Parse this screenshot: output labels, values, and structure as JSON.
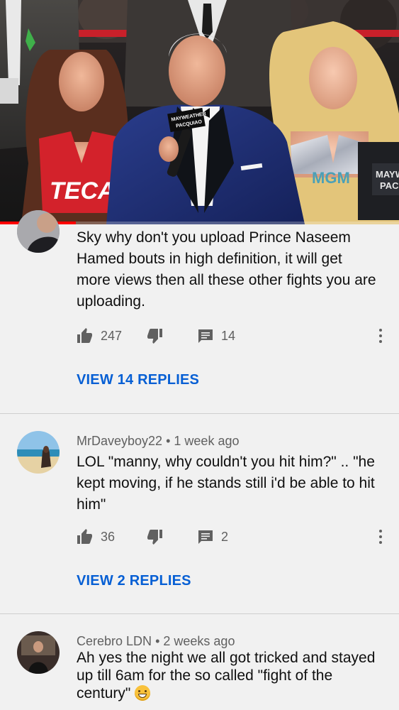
{
  "video": {
    "scene_text": {
      "mic_flag_top": "MAYWEATHER",
      "mic_flag_bottom": "PACQUIAO",
      "left_outfit": "TECATE",
      "right_outfit": "MGM",
      "camera_sign_top": "MAYW",
      "camera_sign_bottom": "PAC"
    },
    "progress_fraction": 0.19,
    "colors": {
      "progress": "#ff0000"
    }
  },
  "comments": [
    {
      "author": "",
      "age": "",
      "avatar": "avatar-photo",
      "text_lines": [
        "Sky why don't you upload Prince Naseem",
        "Hamed bouts in high definition, it will get",
        "more views then all these other fights you are",
        "uploading."
      ],
      "likes": "247",
      "replies": "14",
      "view_replies": "VIEW 14 REPLIES"
    },
    {
      "author": "MrDaveyboy22",
      "separator": "•",
      "age": "1 week ago",
      "avatar": "avatar-photo",
      "text_lines": [
        "LOL \"manny, why couldn't you hit him?\" .. \"he",
        "kept moving, if he stands still i'd be able to hit",
        "him\""
      ],
      "likes": "36",
      "replies": "2",
      "view_replies": "VIEW 2 REPLIES"
    },
    {
      "author": "Cerebro LDN",
      "separator": "•",
      "age": "2 weeks ago",
      "avatar": "avatar-photo",
      "text_lines": [
        "Ah yes the night we all got tricked and stayed",
        "up till 6am for the so called \"fight of the",
        "century\""
      ],
      "emoji": "grinning-sweat-emoji"
    }
  ],
  "icons": {
    "like": "thumbs-up-icon",
    "dislike": "thumbs-down-icon",
    "reply": "comment-icon",
    "more": "more-vertical-icon"
  },
  "colors": {
    "background": "#f1f1f1",
    "link": "#065fd4",
    "meta": "#606060",
    "divider": "#cfcfcf"
  }
}
